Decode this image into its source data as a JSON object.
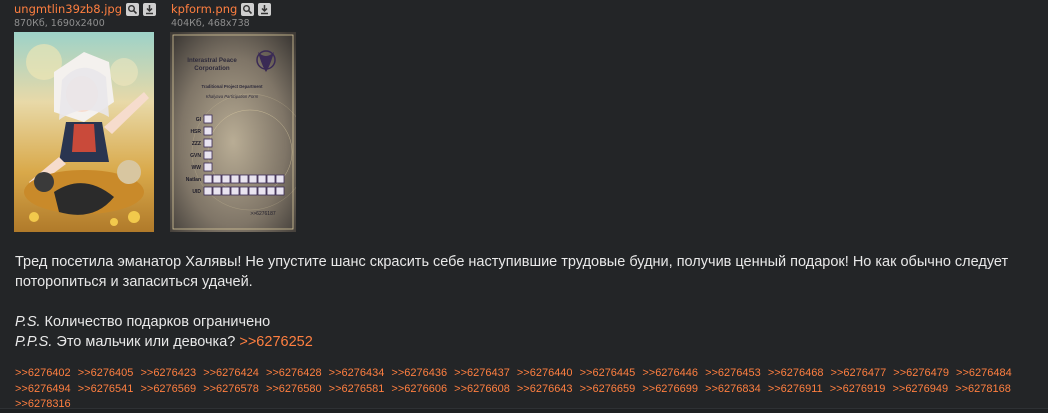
{
  "files": [
    {
      "name": "ungmtlin39zb8.jpg",
      "meta": "870Кб, 1690x2400",
      "icons": [
        "search-icon",
        "download-icon"
      ]
    },
    {
      "name": "kpform.png",
      "meta": "404Кб, 468x738",
      "icons": [
        "search-icon",
        "download-icon"
      ]
    }
  ],
  "form": {
    "title1": "Interastral Peace",
    "title2": "Corporation",
    "dept": "Traditional Project Department",
    "subtitle": "Khalyava Participation Form",
    "rows": [
      "GI",
      "HSR",
      "ZZZ",
      "GVN",
      "WW",
      "Natlan",
      "UID"
    ],
    "stamp": ">>6276187"
  },
  "message": {
    "para1": "Тред посетила эманатор Халявы! Не упустите шанс скрасить себе наступившие трудовые будни, получив ценный подарок! Но как обычно следует поторопиться и запаситься удачей.",
    "ps_label": "P.S.",
    "ps_text": " Количество подарков ограничено",
    "pps_label": "P.P.S.",
    "pps_text": " Это мальчик или девочка? ",
    "pps_link": ">>6276252"
  },
  "replies": [
    ">>6276402",
    ">>6276405",
    ">>6276423",
    ">>6276424",
    ">>6276428",
    ">>6276434",
    ">>6276436",
    ">>6276437",
    ">>6276440",
    ">>6276445",
    ">>6276446",
    ">>6276453",
    ">>6276468",
    ">>6276477",
    ">>6276479",
    ">>6276484",
    ">>6276494",
    ">>6276541",
    ">>6276569",
    ">>6276578",
    ">>6276580",
    ">>6276581",
    ">>6276606",
    ">>6276608",
    ">>6276643",
    ">>6276659",
    ">>6276699",
    ">>6276834",
    ">>6276911",
    ">>6276919",
    ">>6276949",
    ">>6278168",
    ">>6278316"
  ],
  "colors": {
    "background": "#232527",
    "link": "#ff7f40",
    "text": "#e9e9e9",
    "meta": "#8e8e8e"
  }
}
